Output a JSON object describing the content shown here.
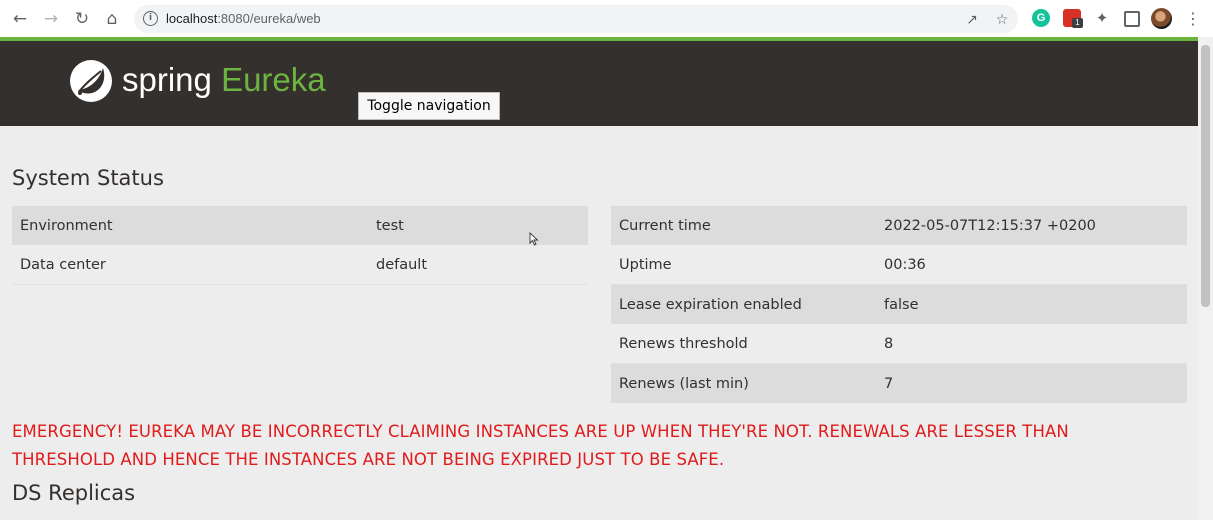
{
  "browser": {
    "url_host": "localhost",
    "url_path": ":8080/eureka/web",
    "back_icon": "arrow-left-icon",
    "forward_icon": "arrow-right-icon",
    "reload_icon": "reload-icon",
    "home_icon": "home-icon",
    "extension_badge": "1"
  },
  "header": {
    "logo_spring": "spring",
    "logo_eureka": "Eureka",
    "toggle_nav_label": "Toggle navigation",
    "colors": {
      "bar": "#34302d",
      "accent": "#6db33f"
    }
  },
  "system_status": {
    "title": "System Status",
    "left_rows": [
      {
        "label": "Environment",
        "value": "test"
      },
      {
        "label": "Data center",
        "value": "default"
      }
    ],
    "right_rows": [
      {
        "label": "Current time",
        "value": "2022-05-07T12:15:37 +0200"
      },
      {
        "label": "Uptime",
        "value": "00:36"
      },
      {
        "label": "Lease expiration enabled",
        "value": "false"
      },
      {
        "label": "Renews threshold",
        "value": "8"
      },
      {
        "label": "Renews (last min)",
        "value": "7"
      }
    ]
  },
  "emergency": {
    "line1": "EMERGENCY! EUREKA MAY BE INCORRECTLY CLAIMING INSTANCES ARE UP WHEN THEY'RE NOT. RENEWALS ARE LESSER THAN",
    "line2": "THRESHOLD AND HENCE THE INSTANCES ARE NOT BEING EXPIRED JUST TO BE SAFE.",
    "color": "#e01b1b"
  },
  "ds_replicas": {
    "title": "DS Replicas"
  }
}
